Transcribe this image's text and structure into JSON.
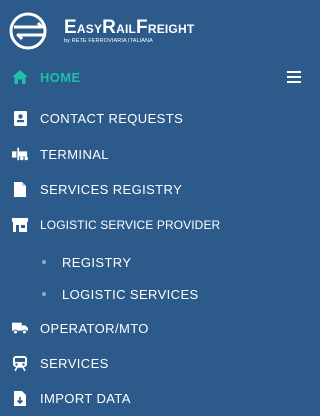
{
  "brand": {
    "name_easy_initial": "E",
    "name_easy_rest": "ASY",
    "name_rail_initial": "R",
    "name_rail_rest": "AIL",
    "name_freight_initial": "F",
    "name_freight_rest": "REIGHT",
    "subtitle": "by RETE FERROVIARIA ITALIANA"
  },
  "nav": {
    "home": "HOME",
    "items": [
      {
        "label": "CONTACT REQUESTS",
        "icon": "contact-card-icon"
      },
      {
        "label": "TERMINAL",
        "icon": "forklift-icon"
      },
      {
        "label": "SERVICES REGISTRY",
        "icon": "document-icon"
      },
      {
        "label": "LOGISTIC SERVICE PROVIDER",
        "icon": "storefront-icon"
      },
      {
        "label": "OPERATOR/MTO",
        "icon": "truck-icon"
      },
      {
        "label": "SERVICES",
        "icon": "train-icon"
      },
      {
        "label": "IMPORT DATA",
        "icon": "import-file-icon"
      }
    ],
    "subitems": [
      {
        "label": "REGISTRY"
      },
      {
        "label": "LOGISTIC SERVICES"
      }
    ]
  },
  "colors": {
    "sidebar_bg": "#2b5a8b",
    "active": "#1ec0a8",
    "text": "#ffffff",
    "bullet": "#8fa9c7"
  }
}
